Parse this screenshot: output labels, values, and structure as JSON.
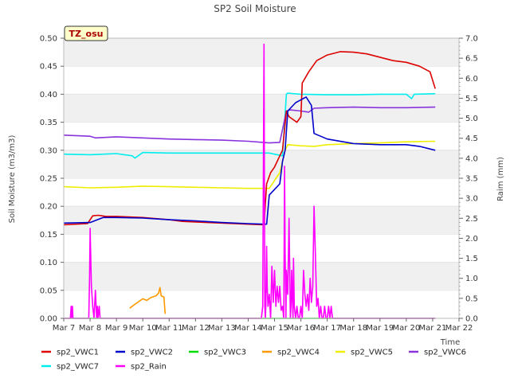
{
  "chart_data": {
    "type": "line",
    "title": "SP2 Soil Moisture",
    "xlabel": "Time",
    "ylabel": "Soil Moisture (m3/m3)",
    "y2label": "Raim (mm)",
    "badge": "TZ_osu",
    "xlim": [
      7,
      22
    ],
    "ylim": [
      0,
      0.5
    ],
    "y2lim": [
      0,
      7
    ],
    "x_ticks": [
      7,
      8,
      9,
      10,
      11,
      12,
      13,
      14,
      15,
      16,
      17,
      18,
      19,
      20,
      21,
      22
    ],
    "x_tick_labels": [
      "Mar 7",
      "Mar 8",
      "Mar 9",
      "Mar 10",
      "Mar 11",
      "Mar 12",
      "Mar 13",
      "Mar 14",
      "Mar 15",
      "Mar 16",
      "Mar 17",
      "Mar 18",
      "Mar 19",
      "Mar 20",
      "Mar 21",
      "Mar 22"
    ],
    "y_ticks": [
      0,
      0.05,
      0.1,
      0.15,
      0.2,
      0.25,
      0.3,
      0.35,
      0.4,
      0.45,
      0.5
    ],
    "y_tick_labels": [
      "0.00",
      "0.05",
      "0.10",
      "0.15",
      "0.20",
      "0.25",
      "0.30",
      "0.35",
      "0.40",
      "0.45",
      "0.50"
    ],
    "y2_ticks": [
      0,
      0.5,
      1,
      1.5,
      2,
      2.5,
      3,
      3.5,
      4,
      4.5,
      5,
      5.5,
      6,
      6.5,
      7
    ],
    "y2_tick_labels": [
      "0.0",
      "0.5",
      "1.0",
      "1.5",
      "2.0",
      "2.5",
      "3.0",
      "3.5",
      "4.0",
      "4.5",
      "5.0",
      "5.5",
      "6.0",
      "6.5",
      "7.0"
    ],
    "grid": "horizontal bands",
    "legend_position": "bottom",
    "series": [
      {
        "name": "sp2_VWC1",
        "color": "#dd0000",
        "axis": "left",
        "x": [
          7,
          7.9,
          8.1,
          8.3,
          8.6,
          9,
          10,
          10.5,
          11,
          11.5,
          12,
          13,
          14,
          14.6,
          14.7,
          14.85,
          15,
          15.1,
          15.2,
          15.3,
          15.45,
          15.55,
          15.7,
          15.85,
          16.0,
          16.05,
          16.3,
          16.6,
          17,
          17.5,
          18,
          18.5,
          19.5,
          20,
          20.5,
          20.9,
          21.1
        ],
        "y": [
          0.167,
          0.169,
          0.183,
          0.184,
          0.182,
          0.182,
          0.18,
          0.178,
          0.176,
          0.173,
          0.172,
          0.17,
          0.168,
          0.167,
          0.24,
          0.26,
          0.27,
          0.28,
          0.29,
          0.3,
          0.37,
          0.36,
          0.355,
          0.35,
          0.36,
          0.42,
          0.44,
          0.46,
          0.47,
          0.476,
          0.475,
          0.472,
          0.46,
          0.457,
          0.45,
          0.44,
          0.41
        ]
      },
      {
        "name": "sp2_VWC2",
        "color": "#0000cc",
        "axis": "left",
        "x": [
          7,
          8,
          8.5,
          9,
          10,
          11,
          11.5,
          12,
          13,
          14,
          14.6,
          14.7,
          14.8,
          15,
          15.2,
          15.3,
          15.4,
          15.5,
          15.8,
          16.0,
          16.2,
          16.4,
          16.5,
          17,
          18,
          19,
          20,
          20.5,
          21.1
        ],
        "y": [
          0.17,
          0.171,
          0.18,
          0.18,
          0.179,
          0.176,
          0.175,
          0.174,
          0.171,
          0.169,
          0.168,
          0.168,
          0.22,
          0.23,
          0.24,
          0.28,
          0.3,
          0.37,
          0.385,
          0.39,
          0.395,
          0.38,
          0.33,
          0.32,
          0.312,
          0.31,
          0.31,
          0.307,
          0.3
        ]
      },
      {
        "name": "sp2_VWC3",
        "color": "#00dd00",
        "axis": "left",
        "x": [
          7,
          21.1
        ],
        "y": [
          0.0,
          0.0
        ]
      },
      {
        "name": "sp2_VWC4",
        "color": "#ff9900",
        "axis": "left",
        "x": [
          9.5,
          9.7,
          9.85,
          10.0,
          10.15,
          10.3,
          10.5,
          10.6,
          10.65,
          10.7,
          10.8,
          10.85
        ],
        "y": [
          0.018,
          0.025,
          0.03,
          0.035,
          0.032,
          0.037,
          0.04,
          0.045,
          0.055,
          0.04,
          0.038,
          0.008
        ]
      },
      {
        "name": "sp2_VWC5",
        "color": "#eeee00",
        "axis": "left",
        "x": [
          7,
          8,
          9,
          10,
          11,
          12,
          13,
          14,
          14.8,
          15.2,
          15.4,
          15.5,
          16,
          16.5,
          17,
          18,
          19,
          20,
          21.1
        ],
        "y": [
          0.235,
          0.233,
          0.234,
          0.236,
          0.235,
          0.234,
          0.233,
          0.232,
          0.232,
          0.26,
          0.3,
          0.31,
          0.308,
          0.307,
          0.31,
          0.312,
          0.313,
          0.315,
          0.316
        ]
      },
      {
        "name": "sp2_VWC6",
        "color": "#8833dd",
        "axis": "left",
        "x": [
          7,
          8,
          8.2,
          9,
          10,
          11,
          12,
          13,
          14,
          14.8,
          15.2,
          15.45,
          15.6,
          16,
          16.3,
          16.5,
          17,
          18,
          19,
          20,
          21.1
        ],
        "y": [
          0.327,
          0.325,
          0.322,
          0.324,
          0.322,
          0.32,
          0.319,
          0.318,
          0.316,
          0.313,
          0.314,
          0.37,
          0.372,
          0.37,
          0.368,
          0.375,
          0.376,
          0.377,
          0.376,
          0.376,
          0.377
        ]
      },
      {
        "name": "sp2_VWC7",
        "color": "#00eeee",
        "axis": "left",
        "x": [
          7,
          8,
          9,
          9.6,
          9.7,
          10,
          11,
          12,
          13,
          14,
          14.8,
          15.3,
          15.45,
          15.5,
          16,
          17,
          18,
          19,
          20,
          20.2,
          20.3,
          21.1
        ],
        "y": [
          0.293,
          0.292,
          0.294,
          0.29,
          0.286,
          0.296,
          0.295,
          0.295,
          0.295,
          0.295,
          0.295,
          0.29,
          0.4,
          0.402,
          0.4,
          0.399,
          0.399,
          0.4,
          0.4,
          0.392,
          0.4,
          0.401
        ]
      },
      {
        "name": "sp2_Rain",
        "color": "#ff00ff",
        "axis": "right",
        "x": [
          7.0,
          7.25,
          7.28,
          7.3,
          7.33,
          7.35,
          7.95,
          7.98,
          8.0,
          8.05,
          8.1,
          8.15,
          8.2,
          8.25,
          8.28,
          8.3,
          8.35,
          8.38,
          8.4,
          14.5,
          14.55,
          14.6,
          14.63,
          14.65,
          14.67,
          14.7,
          14.72,
          14.75,
          14.8,
          14.85,
          14.9,
          14.95,
          15.0,
          15.05,
          15.1,
          15.15,
          15.2,
          15.25,
          15.3,
          15.35,
          15.38,
          15.4,
          15.43,
          15.45,
          15.5,
          15.55,
          15.6,
          15.63,
          15.65,
          15.7,
          15.72,
          15.75,
          15.8,
          15.85,
          15.9,
          15.95,
          16.0,
          16.05,
          16.1,
          16.15,
          16.2,
          16.25,
          16.3,
          16.35,
          16.4,
          16.45,
          16.5,
          16.55,
          16.6,
          16.65,
          16.7,
          16.75,
          16.8,
          16.85,
          16.9,
          16.95,
          17.0,
          17.05,
          17.1,
          17.15,
          17.2,
          21.1
        ],
        "y": [
          0.0,
          0.0,
          0.3,
          0.0,
          0.3,
          0.0,
          0.0,
          1.0,
          2.25,
          0.8,
          0.3,
          0.0,
          0.7,
          0.0,
          0.3,
          0.0,
          0.3,
          0.0,
          0.0,
          0.0,
          0.3,
          6.85,
          0.3,
          0.0,
          0.3,
          1.8,
          0.8,
          0.3,
          0.6,
          0.0,
          1.3,
          0.4,
          1.2,
          0.3,
          0.8,
          0.4,
          0.8,
          0.2,
          0.3,
          0.0,
          3.8,
          1.6,
          0.0,
          1.2,
          0.6,
          2.5,
          0.0,
          0.4,
          1.2,
          0.0,
          1.5,
          0.3,
          0.0,
          0.3,
          0.0,
          0.0,
          0.3,
          0.0,
          1.2,
          0.6,
          0.3,
          0.6,
          0.2,
          1.0,
          0.4,
          0.8,
          2.8,
          1.6,
          0.3,
          0.5,
          0.0,
          0.3,
          0.0,
          0.0,
          0.3,
          0.0,
          0.0,
          0.3,
          0.0,
          0.3,
          0.0,
          0.0
        ]
      }
    ],
    "legend_order": [
      "sp2_VWC1",
      "sp2_VWC2",
      "sp2_VWC3",
      "sp2_VWC4",
      "sp2_VWC5",
      "sp2_VWC6",
      "sp2_VWC7",
      "sp2_Rain"
    ]
  }
}
